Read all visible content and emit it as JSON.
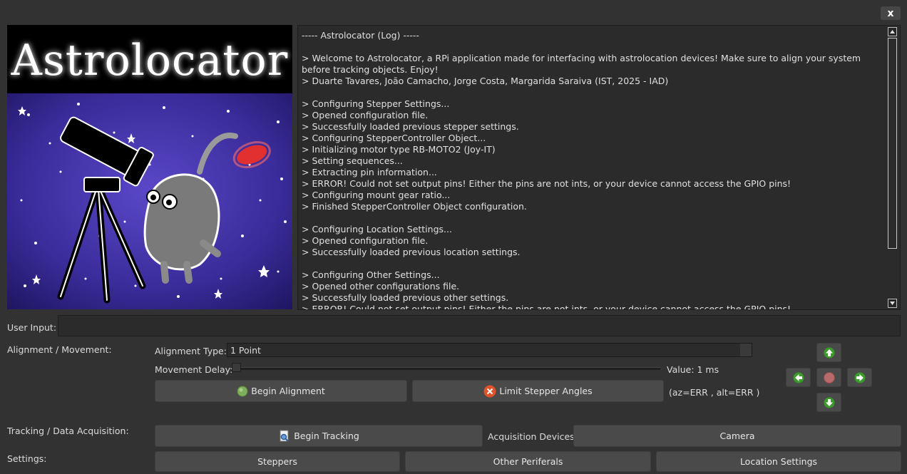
{
  "window": {
    "close_label": "x"
  },
  "banner": {
    "title": "Astrolocator"
  },
  "log": {
    "lines": [
      "----- Astrolocator (Log) -----",
      "",
      "> Welcome to Astrolocator, a RPi application made for interfacing with astrolocation devices! Make sure to align your system before tracking objects. Enjoy!",
      "> Duarte Tavares, João Camacho, Jorge Costa, Margarida Saraiva (IST, 2025 - IAD)",
      "",
      "> Configuring Stepper Settings...",
      "> Opened configuration file.",
      "> Successfully loaded previous stepper settings.",
      "> Configuring StepperController Object...",
      "> Initializing motor type RB-MOTO2 (Joy-IT)",
      "> Setting sequences...",
      "> Extracting pin information...",
      "> ERROR! Could not set output pins! Either the pins are not ints, or your device cannot access the GPIO pins!",
      "> Configuring mount gear ratio...",
      "> Finished StepperController Object configuration.",
      "",
      "> Configuring Location Settings...",
      "> Opened configuration file.",
      "> Successfully loaded previous location settings.",
      "",
      "> Configuring Other Settings...",
      "> Opened other configurations file.",
      "> Successfully loaded previous other settings.",
      "> ERROR! Could not set output pins! Either the pins are not ints, or your device cannot access the GPIO pins!"
    ]
  },
  "user_input": {
    "label": "User Input:",
    "value": ""
  },
  "alignment": {
    "section_label": "Alignment / Movement:",
    "type_label": "Alignment Type:",
    "type_value": "1 Point",
    "delay_label": "Movement Delay:",
    "delay_value_text": "Value: 1 ms",
    "delay_level": 0,
    "begin_alignment_label": "Begin Alignment",
    "limit_angles_label": "Limit Stepper Angles",
    "angles_text": "(az=ERR , alt=ERR )"
  },
  "tracking": {
    "section_label": "Tracking / Data Acquisition:",
    "begin_tracking_label": "Begin Tracking",
    "devices_label": "Acquisition Devices:",
    "device_value": "Camera"
  },
  "settings": {
    "section_label": "Settings:",
    "steppers_label": "Steppers",
    "other_label": "Other Periferals",
    "location_label": "Location Settings"
  },
  "colors": {
    "background": "#323232",
    "button": "#4a4a4a",
    "arrow_green": "#3a9a2a",
    "stop_red": "#b86a6a",
    "limit_icon": "#e0532a",
    "banner_sky": "#3c2c9c"
  },
  "icons": [
    "close-icon",
    "up-arrow-icon",
    "down-arrow-icon",
    "left-arrow-icon",
    "right-arrow-icon",
    "stop-icon",
    "green-dot-icon",
    "x-circle-icon",
    "document-search-icon"
  ]
}
